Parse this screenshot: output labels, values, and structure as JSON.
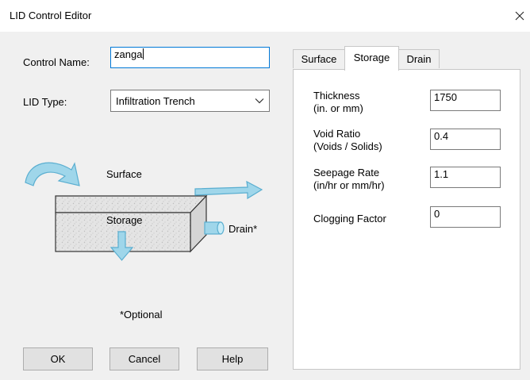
{
  "window": {
    "title": "LID Control Editor"
  },
  "control_name": {
    "label": "Control Name:",
    "value": "zanga"
  },
  "lid_type": {
    "label": "LID Type:",
    "selected": "Infiltration Trench"
  },
  "diagram": {
    "surface": "Surface",
    "storage": "Storage",
    "drain": "Drain*",
    "optional_note": "*Optional"
  },
  "buttons": {
    "ok": "OK",
    "cancel": "Cancel",
    "help": "Help"
  },
  "tabs": [
    {
      "label": "Surface",
      "active": false
    },
    {
      "label": "Storage",
      "active": true
    },
    {
      "label": "Drain",
      "active": false
    }
  ],
  "storage": {
    "thickness": {
      "label_line1": "Thickness",
      "label_line2": "(in. or mm)",
      "value": "1750"
    },
    "void_ratio": {
      "label_line1": "Void Ratio",
      "label_line2": "(Voids / Solids)",
      "value": "0.4"
    },
    "seepage_rate": {
      "label_line1": "Seepage Rate",
      "label_line2": "(in/hr or mm/hr)",
      "value": "1.1"
    },
    "clogging_factor": {
      "label": "Clogging Factor",
      "value": "0"
    }
  },
  "colors": {
    "accent_border": "#0078d7",
    "arrow_fill": "#9fd6ea",
    "arrow_stroke": "#5aaed0",
    "box_fill": "#e2e2e2"
  }
}
